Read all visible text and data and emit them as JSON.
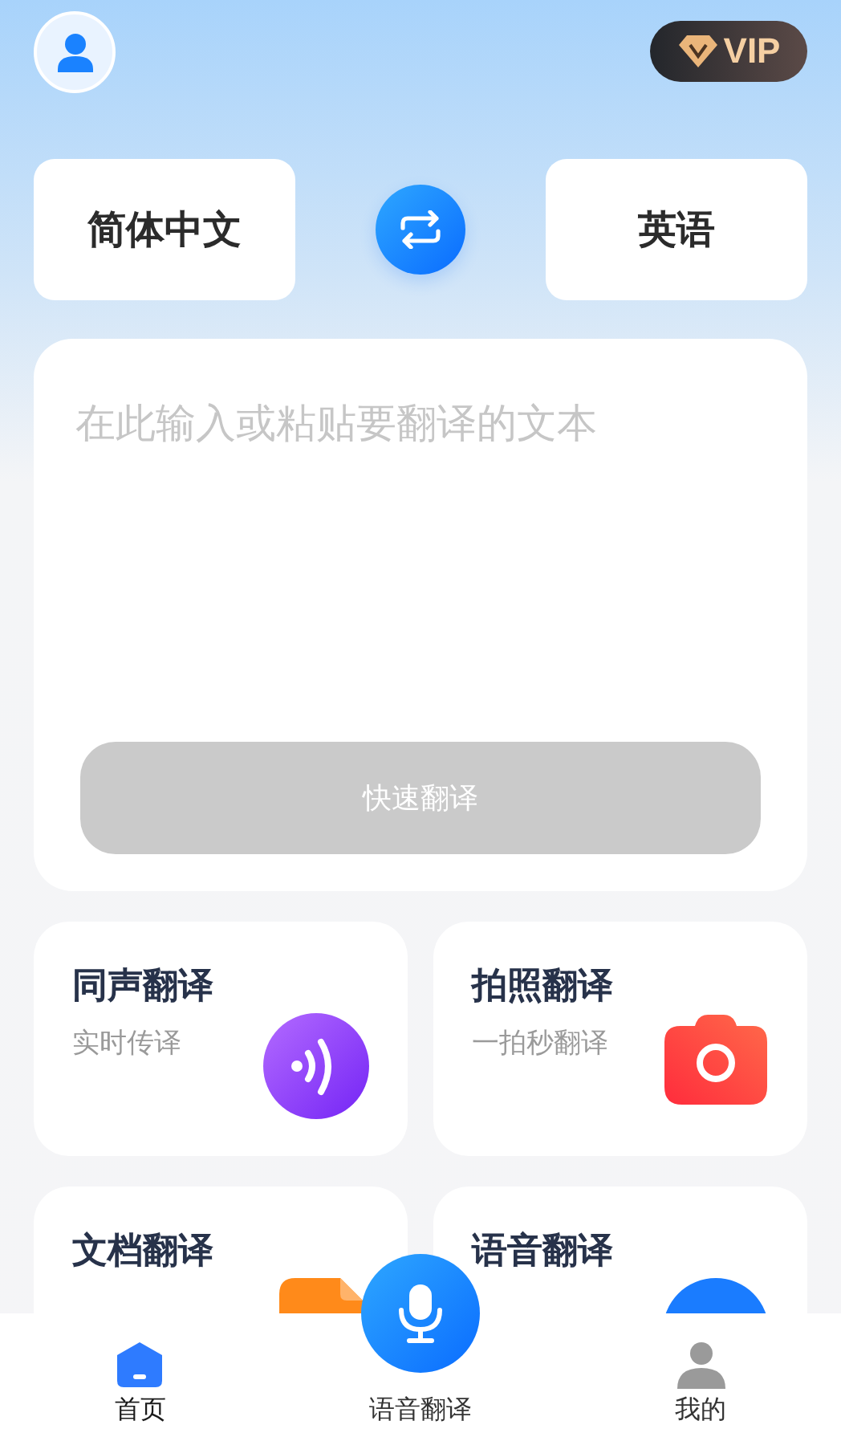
{
  "header": {
    "vip_label": "VIP"
  },
  "languages": {
    "source": "简体中文",
    "target": "英语"
  },
  "input": {
    "placeholder": "在此输入或粘贴要翻译的文本",
    "button": "快速翻译",
    "disabled": true
  },
  "features": [
    {
      "title": "同声翻译",
      "subtitle": "实时传译",
      "kind": "wave"
    },
    {
      "title": "拍照翻译",
      "subtitle": "一拍秒翻译",
      "kind": "camera"
    },
    {
      "title": "文档翻译",
      "kind": "document"
    },
    {
      "title": "语音翻译",
      "kind": "voice"
    }
  ],
  "nav": [
    {
      "label": "首页",
      "kind": "home",
      "selected": true
    },
    {
      "label": "语音翻译",
      "kind": "mic",
      "selected": false
    },
    {
      "label": "我的",
      "kind": "user",
      "selected": false
    }
  ]
}
